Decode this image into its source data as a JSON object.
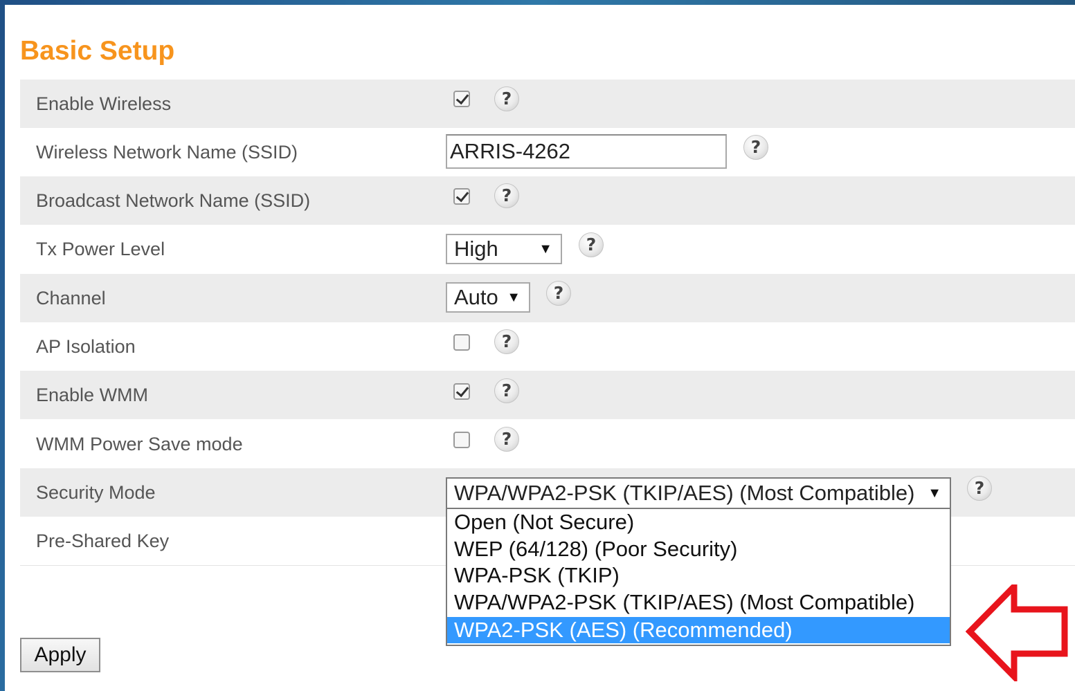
{
  "page": {
    "title": "Basic Setup",
    "accent_color": "#f7941d"
  },
  "rows": [
    {
      "label": "Enable Wireless",
      "control": "checkbox",
      "checked": true
    },
    {
      "label": "Wireless Network Name (SSID)",
      "control": "text",
      "value": "ARRIS-4262"
    },
    {
      "label": "Broadcast Network Name (SSID)",
      "control": "checkbox",
      "checked": true
    },
    {
      "label": "Tx Power Level",
      "control": "select",
      "value": "High"
    },
    {
      "label": "Channel",
      "control": "select",
      "value": "Auto"
    },
    {
      "label": "AP Isolation",
      "control": "checkbox",
      "checked": false
    },
    {
      "label": "Enable WMM",
      "control": "checkbox",
      "checked": true
    },
    {
      "label": "WMM Power Save mode",
      "control": "checkbox",
      "checked": false
    },
    {
      "label": "Security Mode",
      "control": "select",
      "value": "WPA/WPA2-PSK (TKIP/AES) (Most Compatible)"
    },
    {
      "label": "Pre-Shared Key",
      "control": "text",
      "value": ""
    }
  ],
  "help_icon_glyph": "?",
  "select_arrow_glyph": "▼",
  "security_dropdown": {
    "options": [
      "Open (Not Secure)",
      "WEP (64/128) (Poor Security)",
      "WPA-PSK (TKIP)",
      "WPA/WPA2-PSK (TKIP/AES) (Most Compatible)",
      "WPA2-PSK (AES) (Recommended)"
    ],
    "highlighted_index": 4,
    "highlight_color": "#3399ff"
  },
  "apply_label": "Apply",
  "annotation": {
    "icon": "red-arrow-left-icon",
    "color": "#e8141c"
  }
}
